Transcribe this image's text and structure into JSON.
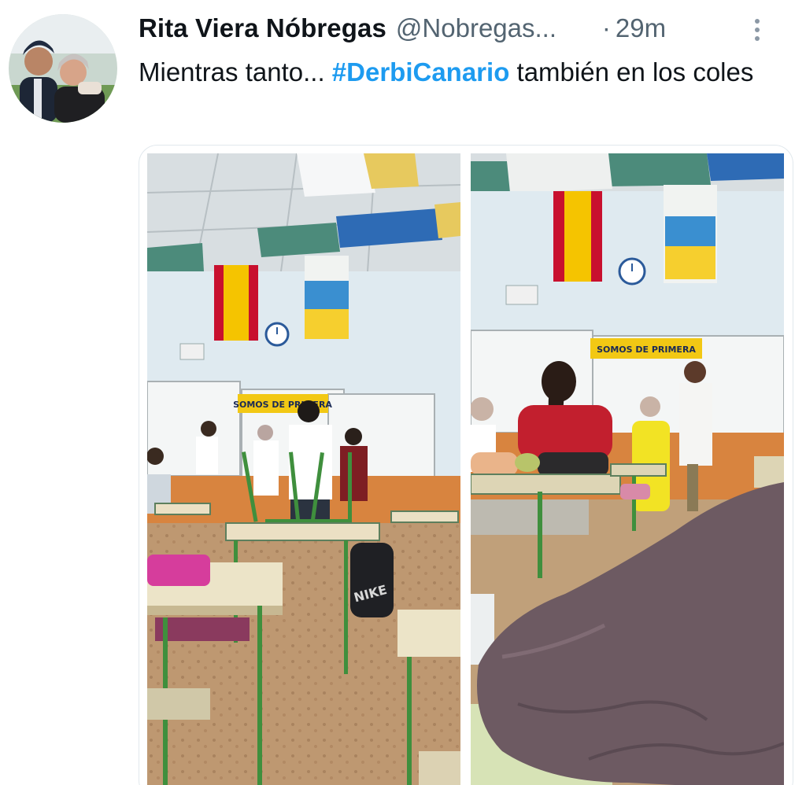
{
  "tweet": {
    "display_name": "Rita Viera Nóbregas",
    "handle": "@Nobregas...",
    "separator": "·",
    "time": "29m",
    "text_before": "Mientras tanto... ",
    "hashtag": "#DerbiCanario",
    "text_after": " también en los coles",
    "more_icon": "more-vertical-icon"
  },
  "media": {
    "photo_count": 2,
    "banner_text": "SOMOS DE PRIMERA",
    "shoe_brand": "NIKE"
  },
  "colors": {
    "text": "#0f1419",
    "secondary": "#536471",
    "link": "#1d9bf0",
    "spain_red": "#c8102e",
    "spain_yellow": "#f5c400",
    "canarias_blue": "#3a8fd0",
    "canarias_yellow": "#f6cf2e"
  }
}
